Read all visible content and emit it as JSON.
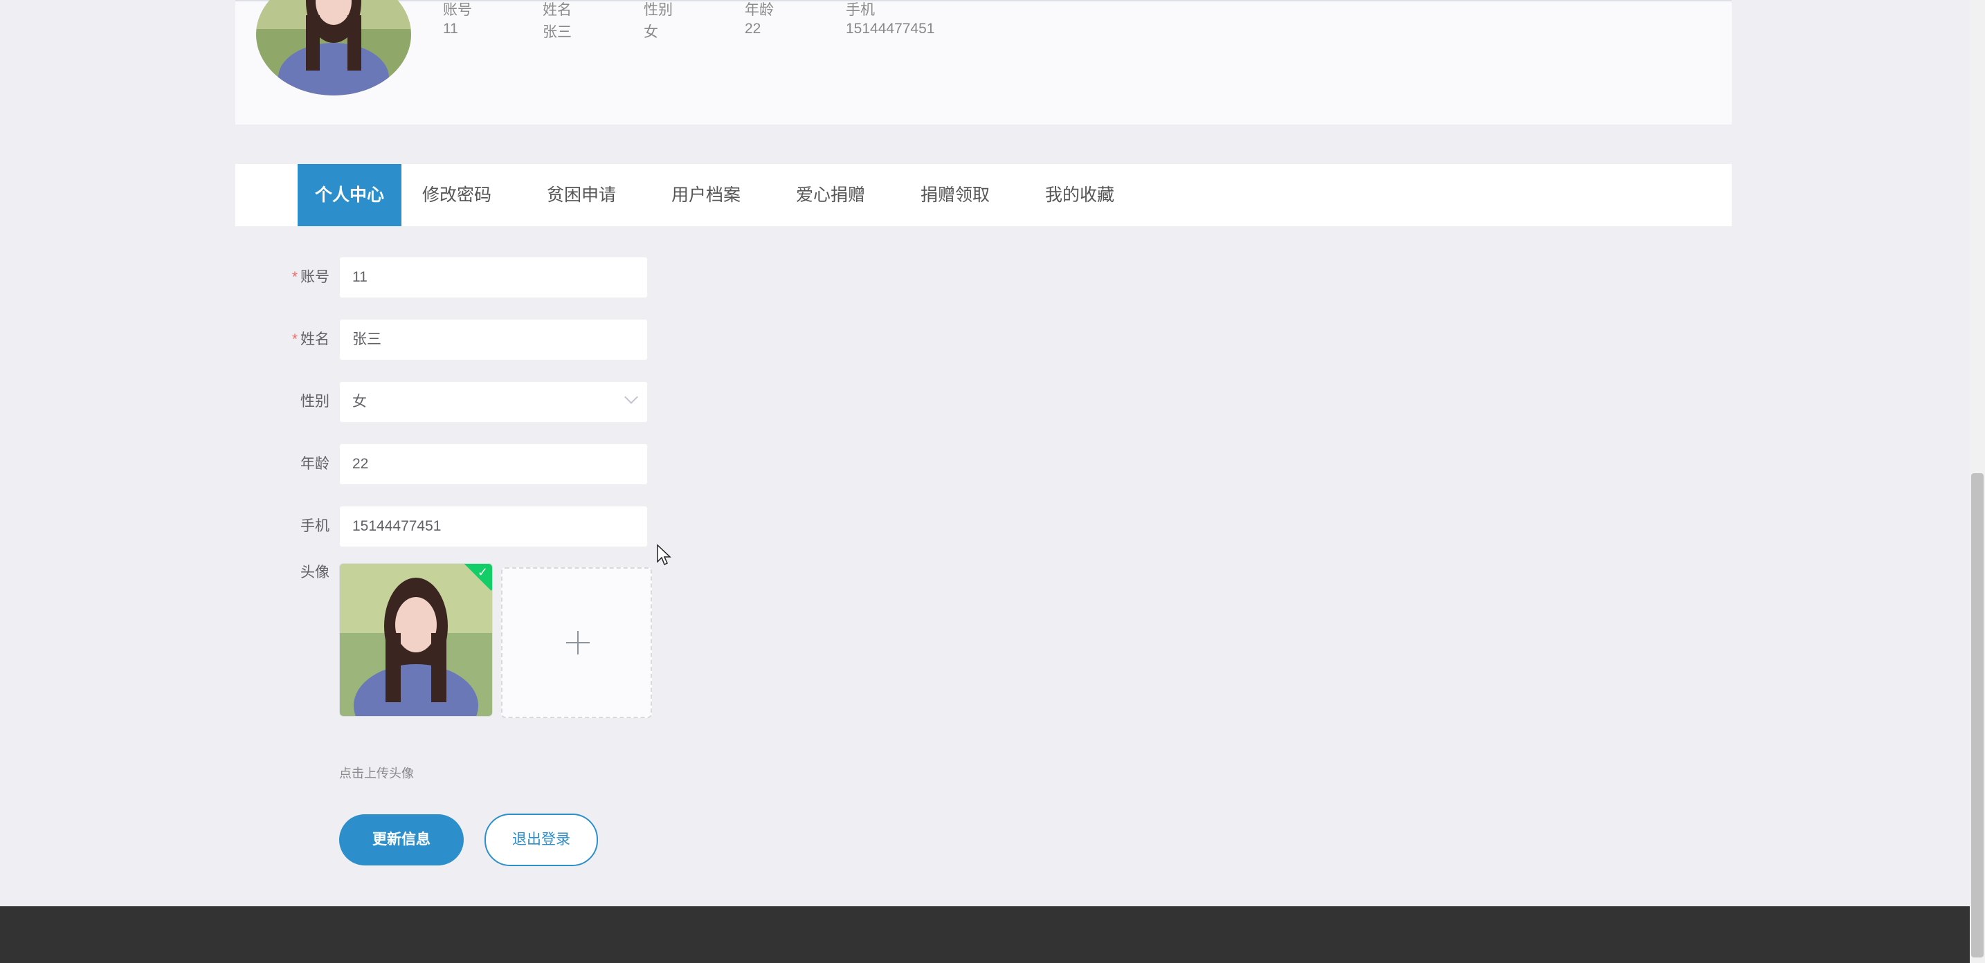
{
  "profile": {
    "fields": [
      {
        "label": "账号",
        "value": "11"
      },
      {
        "label": "姓名",
        "value": "张三"
      },
      {
        "label": "性别",
        "value": "女"
      },
      {
        "label": "年龄",
        "value": "22"
      },
      {
        "label": "手机",
        "value": "15144477451"
      }
    ]
  },
  "tabs": [
    "个人中心",
    "修改密码",
    "贫困申请",
    "用户档案",
    "爱心捐赠",
    "捐赠领取",
    "我的收藏"
  ],
  "form": {
    "account": {
      "label": "账号",
      "value": "11",
      "required": true
    },
    "name": {
      "label": "姓名",
      "value": "张三",
      "required": true
    },
    "gender": {
      "label": "性别",
      "value": "女"
    },
    "age": {
      "label": "年龄",
      "value": "22"
    },
    "phone": {
      "label": "手机",
      "value": "15144477451"
    },
    "avatar": {
      "label": "头像",
      "hint": "点击上传头像"
    }
  },
  "required_mark": "*",
  "buttons": {
    "update": "更新信息",
    "logout": "退出登录"
  },
  "colors": {
    "primary": "#2c8fcc",
    "footer": "#333333",
    "success": "#13ce66"
  }
}
